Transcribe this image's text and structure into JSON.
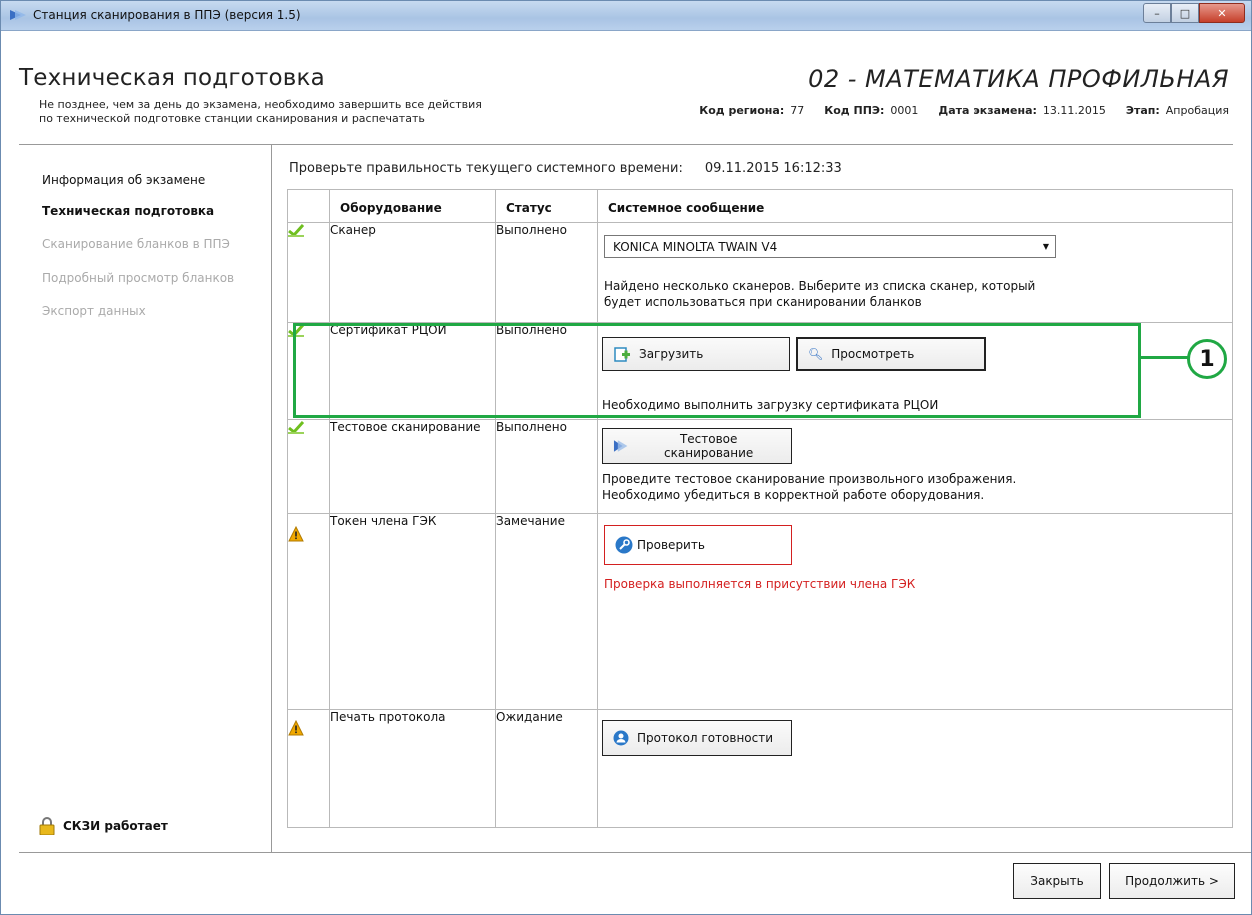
{
  "window": {
    "title": "Станция сканирования в ППЭ (версия 1.5)",
    "minimize": "–",
    "maximize": "□",
    "close": "✕"
  },
  "header": {
    "title": "Техническая подготовка",
    "subtitle_line1": "Не позднее, чем за день до экзамена, необходимо завершить все действия",
    "subtitle_line2": "по технической подготовке станции сканирования и распечатать",
    "subject": "02 - МАТЕМАТИКА ПРОФИЛЬНАЯ",
    "region_label": "Код региона:",
    "region_value": "77",
    "ppe_label": "Код ППЭ:",
    "ppe_value": "0001",
    "date_label": "Дата экзамена:",
    "date_value": "13.11.2015",
    "stage_label": "Этап:",
    "stage_value": "Апробация"
  },
  "nav": {
    "items": [
      {
        "label": "Информация об экзамене"
      },
      {
        "label": "Техническая подготовка"
      },
      {
        "label": "Сканирование бланков в ППЭ"
      },
      {
        "label": "Подробный просмотр бланков"
      },
      {
        "label": "Экспорт данных"
      }
    ],
    "status": "СКЗИ работает"
  },
  "time": {
    "label": "Проверьте правильность текущего системного времени:",
    "value": "09.11.2015 16:12:33"
  },
  "table": {
    "headers": {
      "equipment": "Оборудование",
      "status": "Статус",
      "message": "Системное сообщение"
    },
    "rows": [
      {
        "equipment": "Сканер",
        "status": "Выполнено",
        "select_value": "KONICA MINOLTA TWAIN V4",
        "message_line1": "Найдено несколько сканеров. Выберите из списка сканер, который",
        "message_line2": "будет использоваться при сканировании бланков"
      },
      {
        "equipment": "Сертификат РЦОИ",
        "status": "Выполнено",
        "btn_load": "Загрузить",
        "btn_view": "Просмотреть",
        "message": "Необходимо выполнить загрузку сертификата РЦОИ"
      },
      {
        "equipment": "Тестовое сканирование",
        "status": "Выполнено",
        "btn": "Тестовое сканирование",
        "message_line1": "Проведите тестовое сканирование произвольного изображения.",
        "message_line2": "Необходимо убедиться в корректной работе оборудования."
      },
      {
        "equipment": "Токен члена ГЭК",
        "status": "Замечание",
        "btn": "Проверить",
        "message": "Проверка выполняется в присутствии члена ГЭК"
      },
      {
        "equipment": "Печать протокола",
        "status": "Ожидание",
        "btn": "Протокол готовности"
      }
    ]
  },
  "callout": {
    "label": "1"
  },
  "footer": {
    "close": "Закрыть",
    "next": "Продолжить >"
  },
  "colors": {
    "highlight": "#20a844",
    "warning_text": "#d42020",
    "check": "#6fbf1f",
    "warn_icon": "#f0a800"
  }
}
